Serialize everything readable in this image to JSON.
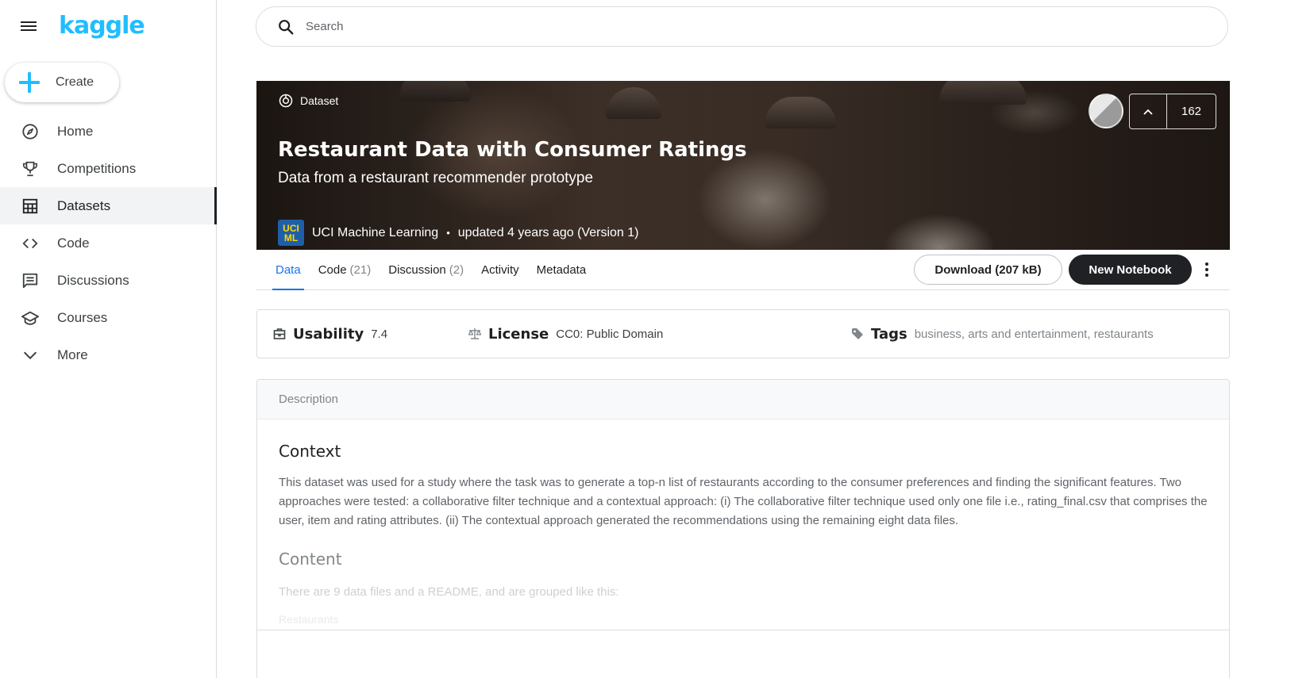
{
  "app": {
    "logo": "kaggle"
  },
  "sidebar": {
    "create_label": "Create",
    "items": [
      {
        "label": "Home",
        "icon": "compass-icon"
      },
      {
        "label": "Competitions",
        "icon": "trophy-icon"
      },
      {
        "label": "Datasets",
        "icon": "table-icon",
        "active": true
      },
      {
        "label": "Code",
        "icon": "code-icon"
      },
      {
        "label": "Discussions",
        "icon": "comment-icon"
      },
      {
        "label": "Courses",
        "icon": "school-icon"
      },
      {
        "label": "More",
        "icon": "chevron-down-icon"
      }
    ]
  },
  "search": {
    "placeholder": "Search"
  },
  "hero": {
    "tag": "Dataset",
    "title": "Restaurant Data with Consumer Ratings",
    "subtitle": "Data from a restaurant recommender prototype",
    "owner_avatar_line1": "UCI",
    "owner_avatar_line2": "ML",
    "owner": "UCI Machine Learning",
    "separator": "•",
    "updated": "updated 4 years ago (Version 1)",
    "vote_count": "162"
  },
  "tabs": [
    {
      "label": "Data",
      "count": "",
      "active": true
    },
    {
      "label": "Code",
      "count": "(21)"
    },
    {
      "label": "Discussion",
      "count": "(2)"
    },
    {
      "label": "Activity",
      "count": ""
    },
    {
      "label": "Metadata",
      "count": ""
    }
  ],
  "actions": {
    "download_label": "Download (207 kB)",
    "new_notebook_label": "New Notebook"
  },
  "meta": {
    "usability_label": "Usability",
    "usability_value": "7.4",
    "license_label": "License",
    "license_value": "CC0: Public Domain",
    "tags_label": "Tags",
    "tags": [
      "business",
      "arts and entertainment",
      "restaurants"
    ],
    "tag_separator": ","
  },
  "description": {
    "header": "Description",
    "context_heading": "Context",
    "context_text": "This dataset was used for a study where the task was to generate a top-n list of restaurants according to the consumer preferences and finding the significant features. Two approaches were tested: a collaborative filter technique and a contextual approach: (i) The collaborative filter technique used only one file i.e., rating_final.csv that comprises the user, item and rating attributes. (ii) The contextual approach generated the recommendations using the remaining eight data files.",
    "content_heading": "Content",
    "content_text": "There are 9 data files and a README, and are grouped like this:",
    "content_list_first": "Restaurants"
  },
  "colors": {
    "brand": "#20beff",
    "tab_active": "#1a73e8",
    "primary_button": "#202124"
  }
}
